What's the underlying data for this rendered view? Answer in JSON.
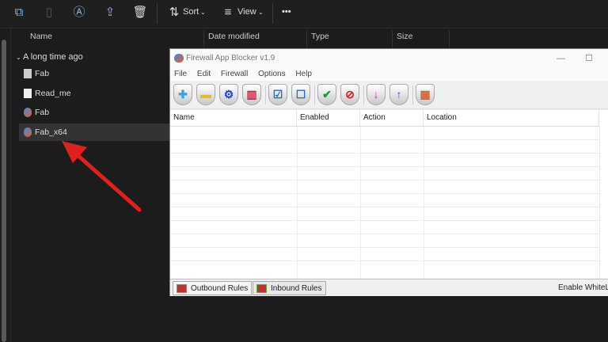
{
  "explorer": {
    "toolbar": {
      "sort_label": "Sort",
      "view_label": "View",
      "more_label": "•••"
    },
    "columns": [
      "Name",
      "Date modified",
      "Type",
      "Size"
    ],
    "group_label": "A long time ago",
    "files": [
      {
        "name": "Fab",
        "icon": "file-icon"
      },
      {
        "name": "Read_me",
        "icon": "text-file-icon"
      },
      {
        "name": "Fab",
        "icon": "app-icon"
      },
      {
        "name": "Fab_x64",
        "icon": "app-icon",
        "selected": true
      }
    ]
  },
  "app": {
    "title": "Firewall App Blocker v1.9",
    "menu": [
      "File",
      "Edit",
      "Firewall",
      "Options",
      "Help"
    ],
    "columns": [
      "Name",
      "Enabled",
      "Action",
      "Location"
    ],
    "tabs": [
      "Outbound Rules",
      "Inbound Rules"
    ],
    "status_right": "Enable WhiteL"
  },
  "colors": {
    "arrow": "#e0201c",
    "accent": "#8ab4e8"
  }
}
